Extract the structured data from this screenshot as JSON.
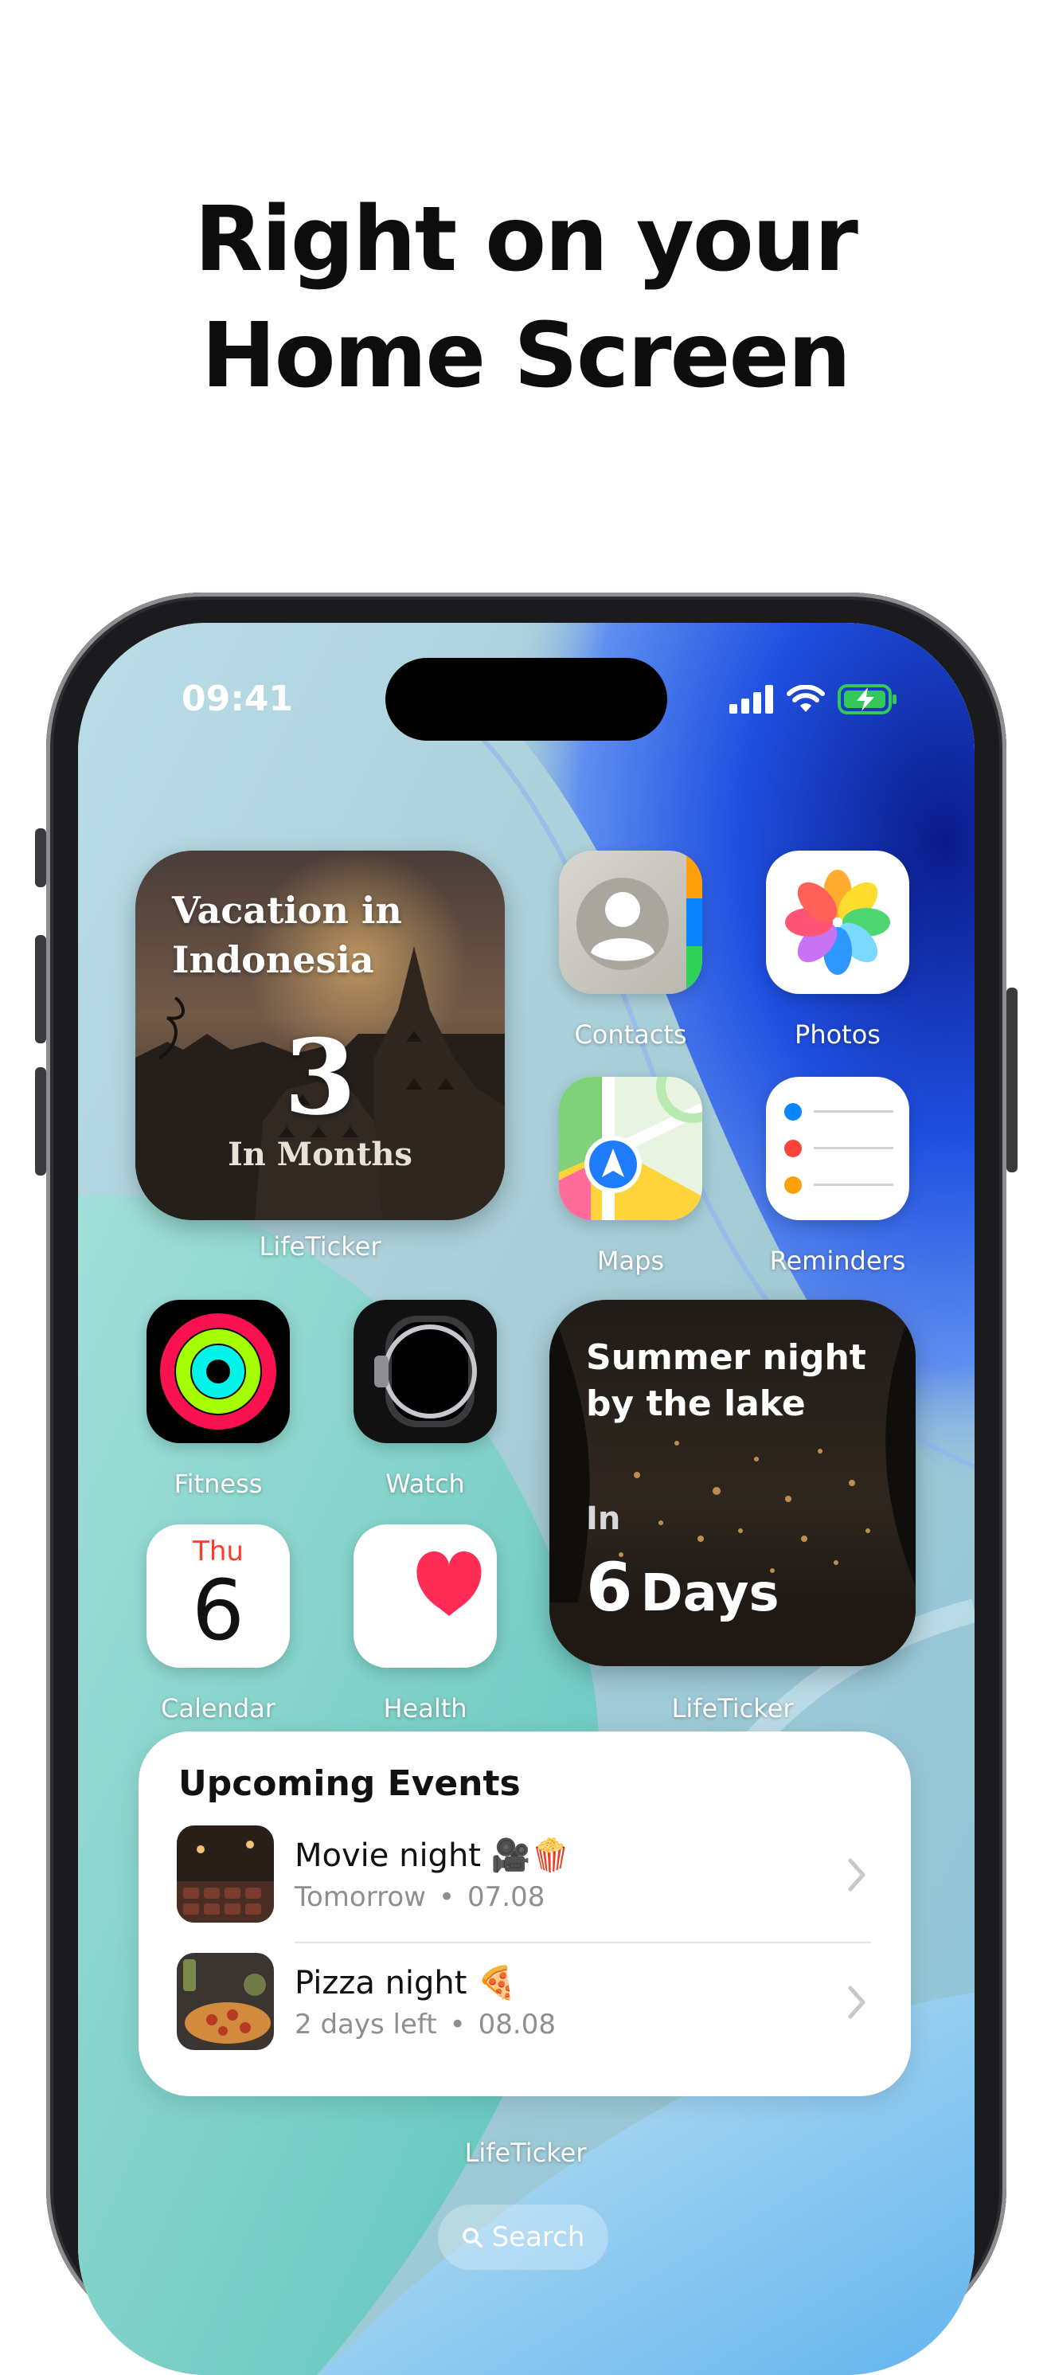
{
  "headline": {
    "line1": "Right on your",
    "line2": "Home Screen"
  },
  "status_bar": {
    "time": "09:41"
  },
  "widgets": {
    "vacation": {
      "title": "Vacation in Indonesia",
      "count": "3",
      "unit": "In Months",
      "label": "LifeTicker"
    },
    "summer": {
      "title": "Summer night by the lake",
      "prefix": "In",
      "count": "6",
      "unit": "Days",
      "label": "LifeTicker"
    },
    "upcoming": {
      "title": "Upcoming Events",
      "label": "LifeTicker",
      "events": [
        {
          "name": "Movie night 🎥🍿",
          "when": "Tomorrow",
          "date": "07.08"
        },
        {
          "name": "Pizza night 🍕",
          "when": "2 days left",
          "date": "08.08"
        }
      ]
    }
  },
  "apps": {
    "contacts": "Contacts",
    "photos": "Photos",
    "maps": "Maps",
    "reminders": "Reminders",
    "fitness": "Fitness",
    "watch": "Watch",
    "calendar": {
      "label": "Calendar",
      "weekday": "Thu",
      "day": "6"
    },
    "health": "Health"
  },
  "search": {
    "label": "Search"
  },
  "colors": {
    "calendar_red": "#ff3b30",
    "health_red": "#ff2d55",
    "accent_blue": "#1f4fe0"
  }
}
